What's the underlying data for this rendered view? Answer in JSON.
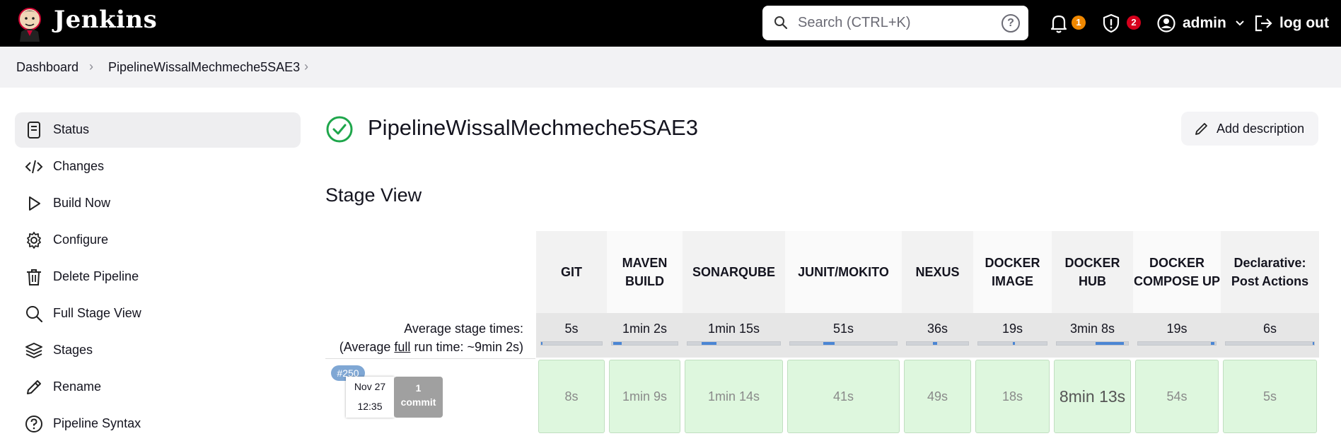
{
  "header": {
    "brand": "Jenkins",
    "search_placeholder": "Search (CTRL+K)",
    "help_icon": "question-circle-icon",
    "notifications_count": "1",
    "security_count": "2",
    "user": "admin",
    "logout": "log out",
    "colors": {
      "notification_badge": "#f08800",
      "security_badge": "#d6001c"
    }
  },
  "breadcrumb": {
    "items": [
      "Dashboard",
      "PipelineWissalMechmeche5SAE3"
    ]
  },
  "sidebar": {
    "items": [
      {
        "label": "Status",
        "icon": "notepad-icon",
        "active": true
      },
      {
        "label": "Changes",
        "icon": "code-icon"
      },
      {
        "label": "Build Now",
        "icon": "play-icon"
      },
      {
        "label": "Configure",
        "icon": "gear-icon"
      },
      {
        "label": "Delete Pipeline",
        "icon": "trash-icon"
      },
      {
        "label": "Full Stage View",
        "icon": "search-icon"
      },
      {
        "label": "Stages",
        "icon": "layers-icon"
      },
      {
        "label": "Rename",
        "icon": "pencil-icon"
      },
      {
        "label": "Pipeline Syntax",
        "icon": "question-circle-icon"
      }
    ]
  },
  "main": {
    "title": "PipelineWissalMechmeche5SAE3",
    "status_color": "#1ea64b",
    "add_description": "Add description",
    "stage_view_title": "Stage View"
  },
  "stage_view": {
    "avg_label": "Average stage times:",
    "run_time_prefix": "(Average ",
    "run_time_full": "full",
    "run_time_suffix": " run time: ~9min 2s)",
    "stages": [
      {
        "name": "GIT",
        "avg": "5s",
        "avg_fraction": 0.02
      },
      {
        "name": "MAVEN BUILD",
        "avg": "1min 2s",
        "avg_fraction": 0.13
      },
      {
        "name": "SONARQUBE",
        "avg": "1min 15s",
        "avg_fraction": 0.16
      },
      {
        "name": "JUNIT/MOKITO",
        "avg": "51s",
        "avg_fraction": 0.11
      },
      {
        "name": "NEXUS",
        "avg": "36s",
        "avg_fraction": 0.08
      },
      {
        "name": "DOCKER IMAGE",
        "avg": "19s",
        "avg_fraction": 0.04
      },
      {
        "name": "DOCKER HUB",
        "avg": "3min 8s",
        "avg_fraction": 0.4
      },
      {
        "name": "DOCKER COMPOSE UP",
        "avg": "19s",
        "avg_fraction": 0.04
      },
      {
        "name": "Declarative: Post Actions",
        "avg": "6s",
        "avg_fraction": 0.02
      }
    ],
    "run": {
      "number": "#250",
      "date": "Nov 27",
      "time": "12:35",
      "commit_count": "1",
      "commit_label": "commit",
      "durations": [
        "8s",
        "1min 9s",
        "1min 14s",
        "41s",
        "49s",
        "18s",
        "8min 13s",
        "54s",
        "5s"
      ],
      "status_color": "#def7de"
    }
  }
}
